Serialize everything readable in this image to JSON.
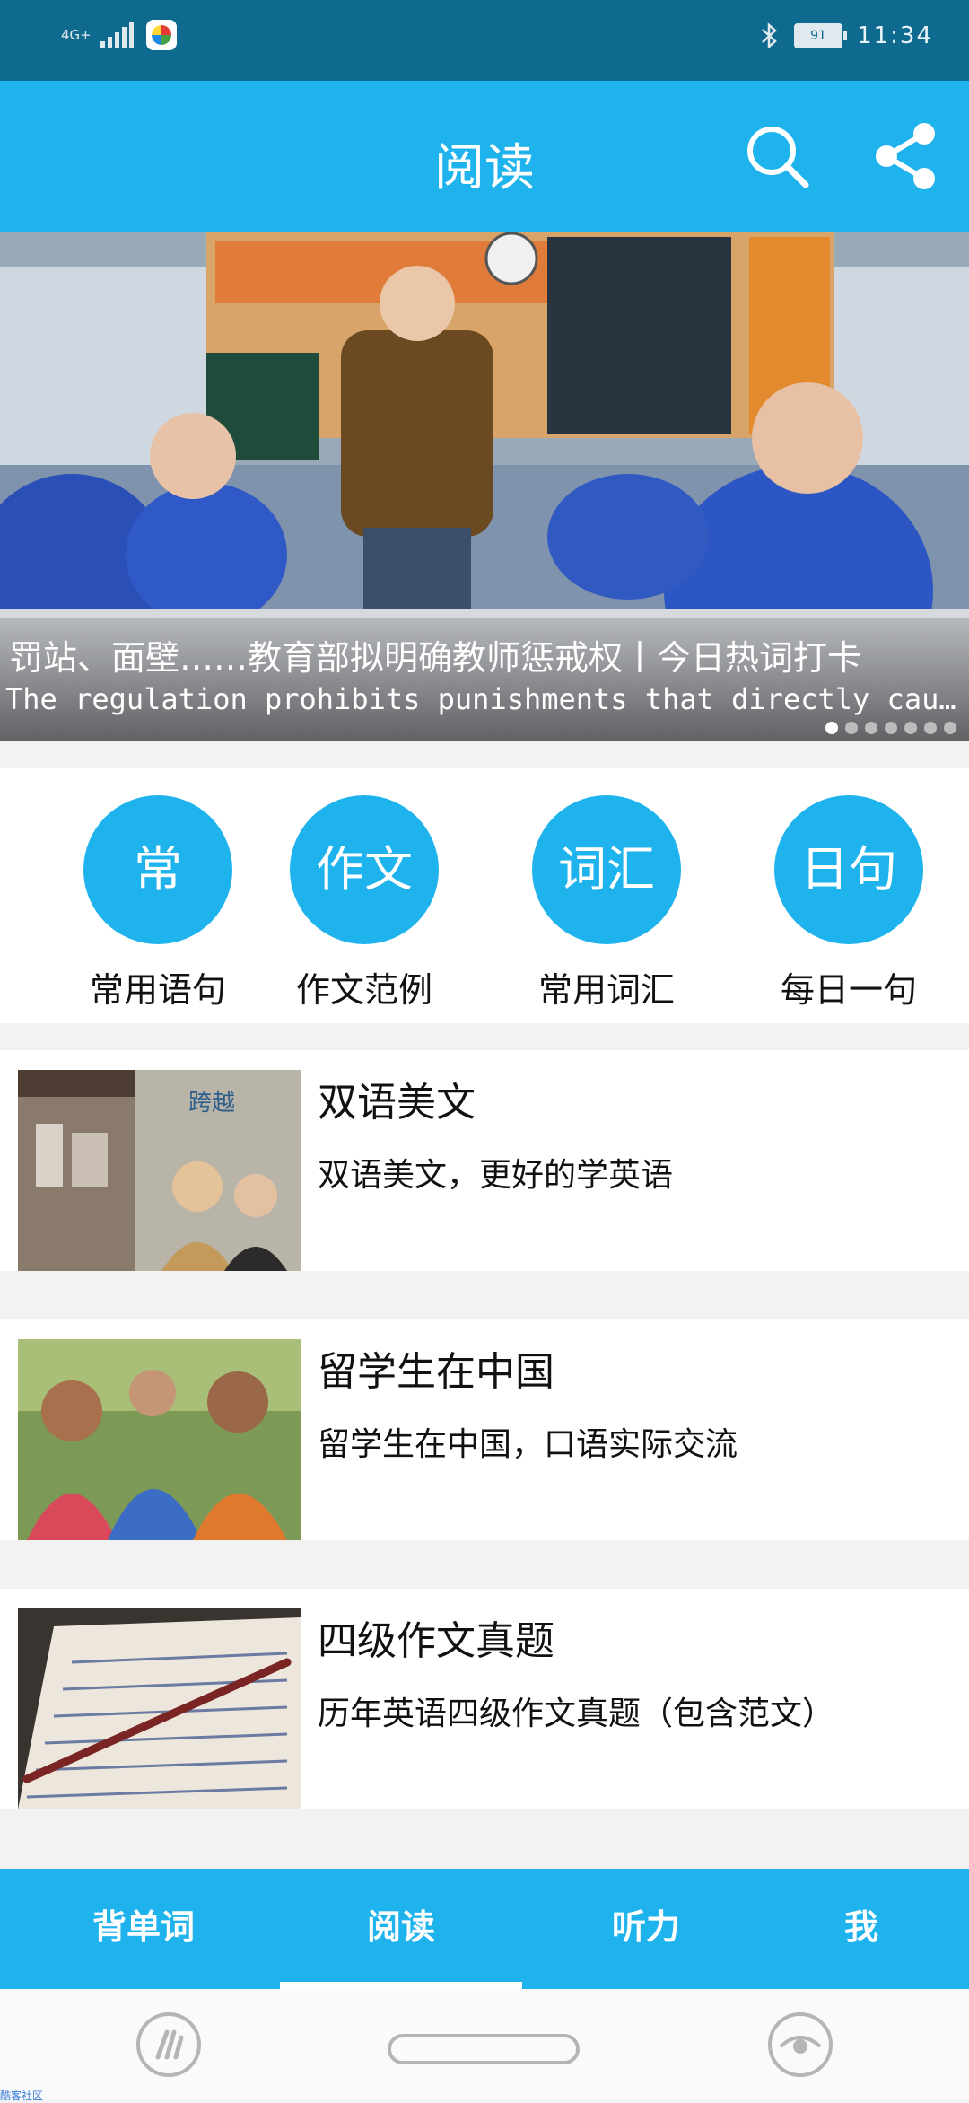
{
  "status_bar": {
    "network": "4G+",
    "battery": "91",
    "time": "11:34"
  },
  "header": {
    "title": "阅读",
    "search_icon": "search-icon",
    "share_icon": "share-icon"
  },
  "banner": {
    "title": "罚站、面壁……教育部拟明确教师惩戒权丨今日热词打卡",
    "subtitle": "The regulation prohibits punishments that directly cause physical harm",
    "dot_count": 7,
    "active_dot": 0
  },
  "shortcuts": [
    {
      "icon_text": "常",
      "label": "常用语句"
    },
    {
      "icon_text": "作文",
      "label": "作文范例"
    },
    {
      "icon_text": "词汇",
      "label": "常用词汇"
    },
    {
      "icon_text": "日句",
      "label": "每日一句"
    }
  ],
  "cards": [
    {
      "title": "双语美文",
      "desc": "双语美文，更好的学英语"
    },
    {
      "title": "留学生在中国",
      "desc": "留学生在中国，口语实际交流"
    },
    {
      "title": "四级作文真题",
      "desc": "历年英语四级作文真题（包含范文）"
    }
  ],
  "bottom_nav": {
    "tabs": [
      {
        "label": "背单词"
      },
      {
        "label": "阅读"
      },
      {
        "label": "听力"
      },
      {
        "label": "我"
      }
    ],
    "active_index": 1
  },
  "watermark": "酷客社区",
  "colors": {
    "primary": "#1fb3ee",
    "status_bar": "#0f6a8f"
  }
}
